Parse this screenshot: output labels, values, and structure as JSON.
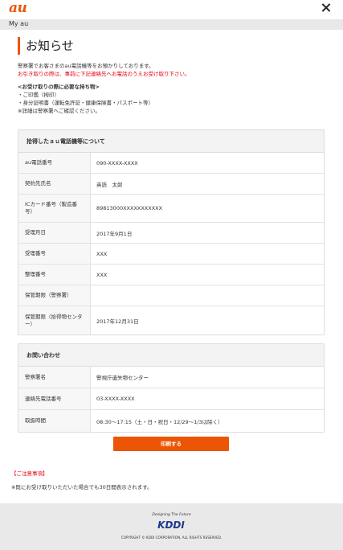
{
  "header": {
    "logo": "au"
  },
  "nav": {
    "label": "My au"
  },
  "page": {
    "title": "お知らせ",
    "intro_line1": "警察署でお客さまのau電話機等をお預かりしております。",
    "intro_line2": "お引き取りの際は、事前に下記連絡先へお電話のうえお受け取り下さい。",
    "items_heading": "<お受け取りの際に必要な持ち物>",
    "items": [
      "・ご印鑑（拇印）",
      "・身分証明書（運転免許証・健康保険書・パスポート等）",
      "※詳細は警察署へご確認ください。"
    ]
  },
  "device_card": {
    "heading": "拾得したａｕ電話機等について",
    "rows": [
      {
        "label": "au電話番号",
        "value": "090-XXXX-XXXX"
      },
      {
        "label": "契約先氏名",
        "value": "英語　太郎"
      },
      {
        "label": "ICカード番号（製造番号）",
        "value": "89813000XXXXXXXXXXX"
      },
      {
        "label": "受理月日",
        "value": "2017年9月1日"
      },
      {
        "label": "受理番号",
        "value": "XXX"
      },
      {
        "label": "整理番号",
        "value": "XXX"
      },
      {
        "label": "保管期限（警察署）",
        "value": ""
      },
      {
        "label": "保管期限（拾得物センター）",
        "value": "2017年12月31日"
      }
    ]
  },
  "contact_card": {
    "heading": "お問い合わせ",
    "rows": [
      {
        "label": "警察署名",
        "value": "警視庁遺失物センター"
      },
      {
        "label": "連絡先電話番号",
        "value": " 03-XXXX-XXXX"
      },
      {
        "label": "取扱時間",
        "value": "08:30～17:15（土・日・祝日・12/29～1/3は除く）"
      }
    ]
  },
  "print_button": "印刷する",
  "notes": {
    "title": "【ご注意事項】",
    "body": "※既にお受け取りいただいた場合でも30日間表示されます。"
  },
  "footer": {
    "tagline": "Designing The Future",
    "brand": "KDDI",
    "copyright": "COPYRIGHT © KDDI CORPORATION, ALL RIGHTS RESERVED."
  },
  "colors": {
    "accent": "#eb5505",
    "warning": "#e60012"
  }
}
